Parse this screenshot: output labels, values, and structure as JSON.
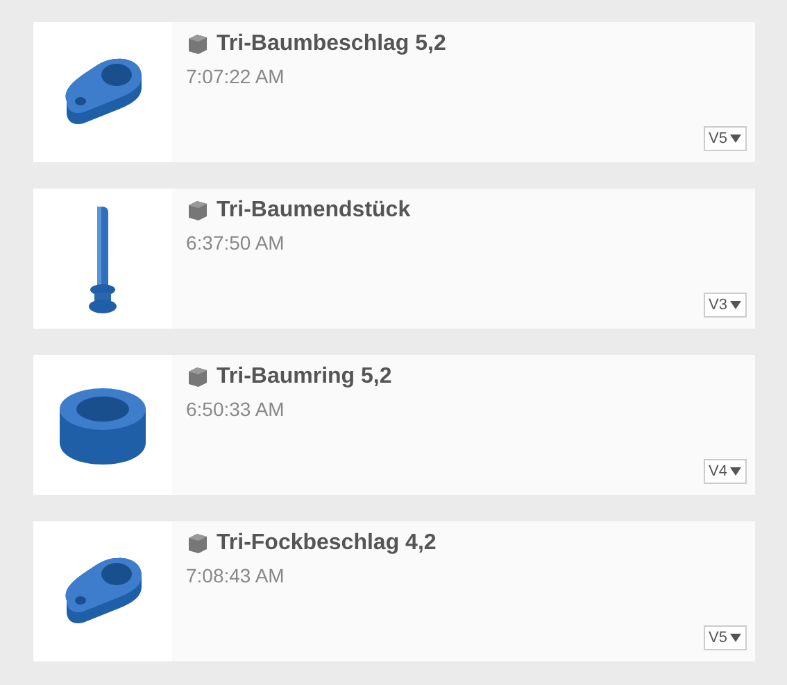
{
  "designs": [
    {
      "kind": "bracket",
      "name": "Tri-Baumbeschlag 5,2",
      "time": "7:07:22 AM",
      "version": "V5"
    },
    {
      "kind": "pin",
      "name": "Tri-Baumendstück",
      "time": "6:37:50 AM",
      "version": "V3"
    },
    {
      "kind": "ring",
      "name": "Tri-Baumring 5,2",
      "time": "6:50:33 AM",
      "version": "V4"
    },
    {
      "kind": "bracket",
      "name": "Tri-Fockbeschlag 4,2",
      "time": "7:08:43 AM",
      "version": "V5"
    }
  ]
}
